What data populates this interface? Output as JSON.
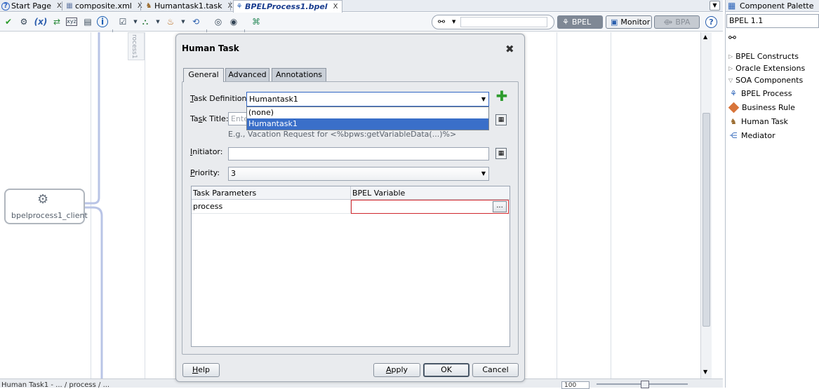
{
  "tabs": [
    {
      "label": "Start Page",
      "icon": "help-icon",
      "close": "X"
    },
    {
      "label": "composite.xml",
      "icon": "composite-icon",
      "close": "X"
    },
    {
      "label": "Humantask1.task",
      "icon": "task-icon",
      "close": "X"
    },
    {
      "label": "BPELProcess1.bpel",
      "icon": "bpel-icon",
      "close": "X"
    }
  ],
  "toolbar": {
    "bpel_label": "BPEL",
    "monitor_label": "Monitor",
    "bpa_label": "BPA",
    "help_glyph": "?"
  },
  "canvas": {
    "vertical_label": "rocess1",
    "client_node_label": "bpelprocess1_client"
  },
  "palette": {
    "title": "Component Palette",
    "dropdown_value": "BPEL 1.1",
    "sections": [
      {
        "label": "BPEL Constructs",
        "expanded": false
      },
      {
        "label": "Oracle Extensions",
        "expanded": false
      },
      {
        "label": "SOA Components",
        "expanded": true
      }
    ],
    "items": [
      "BPEL Process",
      "Business Rule",
      "Human Task",
      "Mediator"
    ]
  },
  "dialog": {
    "title": "Human Task",
    "close_glyph": "✖",
    "tabs": [
      "General",
      "Advanced",
      "Annotations"
    ],
    "task_definition": {
      "label_ul": "T",
      "label_rest": "ask Definition:",
      "value": "Humantask1",
      "options": [
        "(none)",
        "Humantask1"
      ],
      "selected_option": "Humantask1"
    },
    "task_title": {
      "label_pre": "Ta",
      "label_ul": "s",
      "label_rest": "k Title:",
      "placeholder": "Ente",
      "hint": "E.g., Vacation Request for <%bpws:getVariableData(...)%>"
    },
    "initiator": {
      "label_ul": "I",
      "label_rest": "nitiator:",
      "value": ""
    },
    "priority": {
      "label_ul": "P",
      "label_rest": "riority:",
      "value": "3"
    },
    "params_table": {
      "headers": [
        "Task Parameters",
        "BPEL Variable"
      ],
      "rows": [
        {
          "param": "process",
          "variable": ""
        }
      ],
      "browse_label": "..."
    },
    "buttons": {
      "help_ul": "H",
      "help_rest": "elp",
      "apply_ul": "A",
      "apply_rest": "pply",
      "ok": "OK",
      "cancel": "Cancel"
    }
  },
  "statusbar": {
    "path_text": "Human Task1 - ... / process / ...",
    "zoom_value": "100"
  },
  "colors": {
    "accent_blue": "#3166c4",
    "selection": "#3a6fc9",
    "error_border": "#d0282d",
    "add_green": "#2e9c2e"
  }
}
